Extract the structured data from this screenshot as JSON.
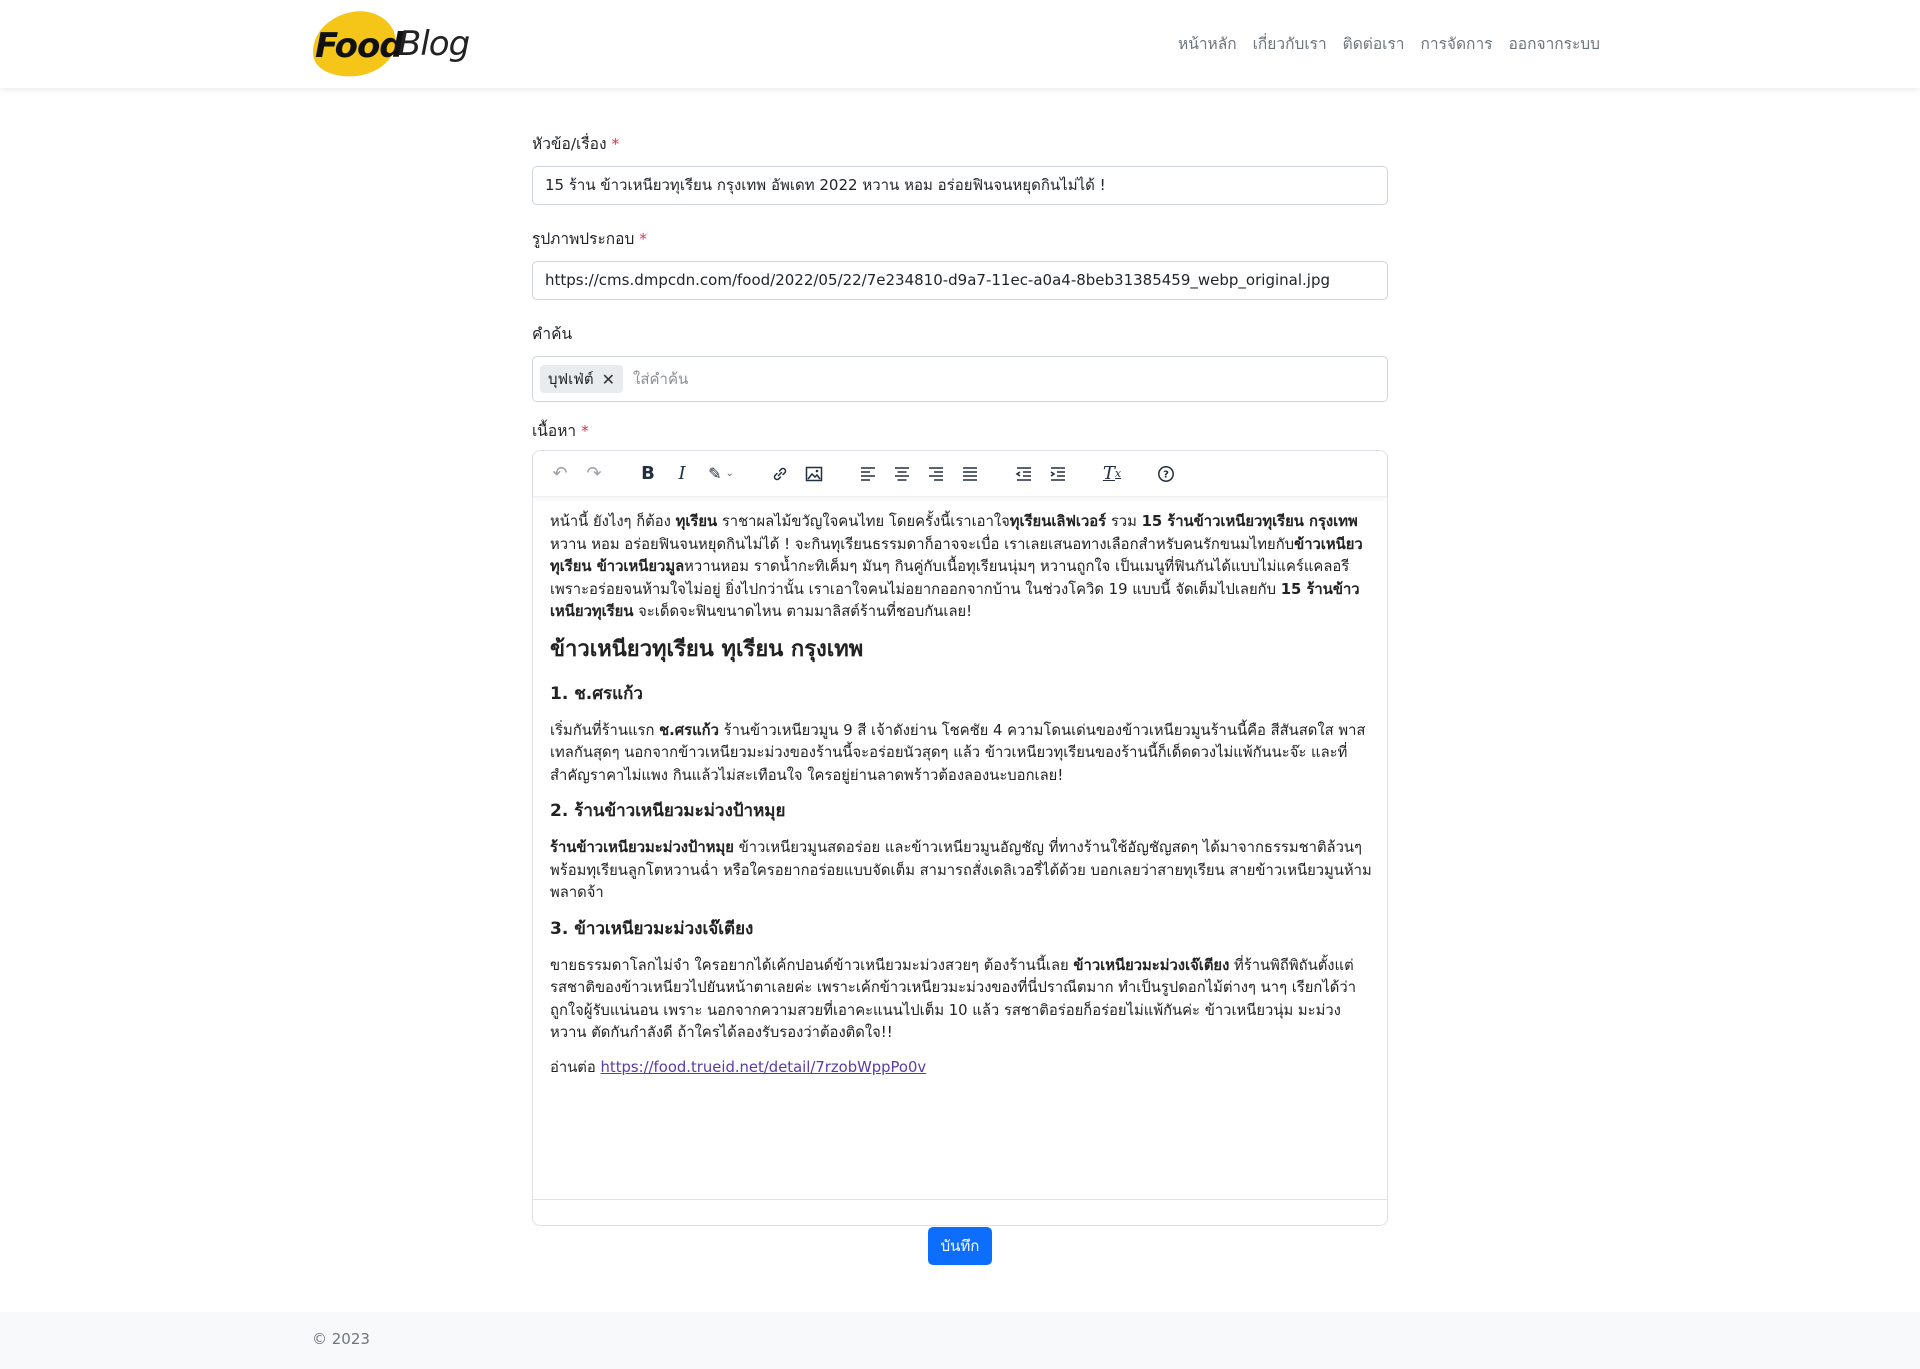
{
  "brand": {
    "food": "Food",
    "blog": "Blog"
  },
  "nav": {
    "items": [
      {
        "label": "หน้าหลัก"
      },
      {
        "label": "เกี่ยวกับเรา"
      },
      {
        "label": "ติดต่อเรา"
      },
      {
        "label": "การจัดการ"
      },
      {
        "label": "ออกจากระบบ"
      }
    ]
  },
  "form": {
    "title_label": "หัวข้อ/เรื่อง",
    "title_value": "15 ร้าน ข้าวเหนียวทุเรียน กรุงเทพ อัพเดท 2022 หวาน หอม อร่อยฟินจนหยุดกินไม่ได้ !",
    "image_label": "รูปภาพประกอบ",
    "image_value": "https://cms.dmpcdn.com/food/2022/05/22/7e234810-d9a7-11ec-a0a4-8beb31385459_webp_original.jpg",
    "keywords_label": "คำค้น",
    "keyword_tag": "บุฟเฟ่ต์",
    "keyword_placeholder": "ใส่คำค้น",
    "content_label": "เนื้อหา",
    "required_mark": "*",
    "save_label": "บันทึก"
  },
  "toolbar": {
    "icons": [
      "undo-icon",
      "redo-icon",
      "bold-icon",
      "italic-icon",
      "highlight-icon",
      "link-icon",
      "image-icon",
      "align-left-icon",
      "align-center-icon",
      "align-right-icon",
      "align-justify-icon",
      "outdent-icon",
      "indent-icon",
      "clear-format-icon",
      "help-icon"
    ]
  },
  "content": {
    "intro": {
      "t1": "หน้านี้ ยังไงๆ ก็ต้อง ",
      "b1": "ทุเรียน",
      "t2": " ราชาผลไม้ขวัญใจคนไทย โดยครั้งนี้เราเอาใจ",
      "b2": "ทุเรียนเลิฟเวอร์",
      "t3": " รวม ",
      "b3": "15 ร้านข้าวเหนียวทุเรียน กรุงเทพ",
      "t4": " หวาน หอม อร่อยฟินจนหยุดกินไม่ได้ ! จะกินทุเรียนธรรมดาก็อาจจะเบื่อ เราเลยเสนอทางเลือกสำหรับคนรักขนมไทยกับ",
      "b4": "ข้าวเหนียวทุเรียน ข้าวเหนียวมูล",
      "t5": "หวานหอม ราดน้ำกะทิเค็มๆ มันๆ กินคู่กับเนื้อทุเรียนนุ่มๆ หวานถูกใจ เป็นเมนูที่ฟินกันได้แบบไม่แคร์แคลอรี เพราะอร่อยจนห้ามใจไม่อยู่ ยิ่งไปกว่านั้น เราเอาใจคนไม่อยากออกจากบ้าน ในช่วงโควิด 19 แบบนี้ จัดเต็มไปเลยกับ ",
      "b5": "15 ร้านข้าวเหนียวทุเรียน",
      "t6": " จะเด็ดจะฟินขนาดไหน ตามมาลิสต์ร้านที่ชอบกันเลย!"
    },
    "heading": "ข้าวเหนียวทุเรียน ทุเรียน กรุงเทพ",
    "s1": {
      "title": "1. ช.ศรแก้ว",
      "t1": "เริ่มกันที่ร้านแรก ",
      "b1": "ช.ศรแก้ว",
      "t2": " ร้านข้าวเหนียวมูน 9 สี เจ้าดังย่าน โชคชัย 4 ความโดนเด่นของข้าวเหนียวมูนร้านนี้คือ สีสันสดใส พาสเทลกันสุดๆ นอกจากข้าวเหนียวมะม่วงของร้านนี้จะอร่อยนัวสุดๆ แล้ว ข้าวเหนียวทุเรียนของร้านนี้ก็เด็ดดวงไม่แพ้กันนะจ๊ะ และที่สำคัญราคาไม่แพง กินแล้วไม่สะเทือนใจ ใครอยู่ย่านลาดพร้าวต้องลองนะบอกเลย!"
    },
    "s2": {
      "title": "2. ร้านข้าวเหนียวมะม่วงป้าหมุย",
      "b1": "ร้านข้าวเหนียวมะม่วงป้าหมุย",
      "t1": " ข้าวเหนียวมูนสดอร่อย และข้าวเหนียวมูนอัญชัญ ที่ทางร้านใช้อัญชัญสดๆ ได้มาจากธรรมชาติล้วนๆ พร้อมทุเรียนลูกโตหวานฉ่ำ หรือใครอยากอร่อยแบบจัดเต็ม สามารถสั่งเดลิเวอรี่ได้ด้วย บอกเลยว่าสายทุเรียน สายข้าวเหนียวมูนห้ามพลาดจ้า"
    },
    "s3": {
      "title": "3. ข้าวเหนียวมะม่วงเจ๊เตียง",
      "t1": "ขายธรรมดาโลกไม่จำ ใครอยากได้เค้กปอนด์ข้าวเหนียวมะม่วงสวยๆ ต้องร้านนี้เลย ",
      "b1": "ข้าวเหนียวมะม่วงเจ๊เตียง",
      "t2": " ที่ร้านพิถีพิถันตั้งแต่รสชาติของข้าวเหนียวไปยันหน้าตาเลยค่ะ เพราะเค้กข้าวเหนียวมะม่วงของที่นี่ปราณีตมาก ทำเป็นรูปดอกไม้ต่างๆ นาๆ เรียกได้ว่าถูกใจผู้รับแน่นอน เพราะ นอกจากความสวยที่เอาคะแนนไปเต็ม 10 แล้ว รสชาติอร่อยก็อร่อยไม่แพ้กันค่ะ ข้าวเหนียวนุ่ม มะม่วงหวาน ตัดกันกำลังดี ถ้าใครได้ลองรับรองว่าต้องติดใจ!!"
    },
    "read_more": "อ่านต่อ ",
    "link": "https://food.trueid.net/detail/7rzobWppPo0v"
  },
  "footer": {
    "copyright": "© 2023"
  }
}
